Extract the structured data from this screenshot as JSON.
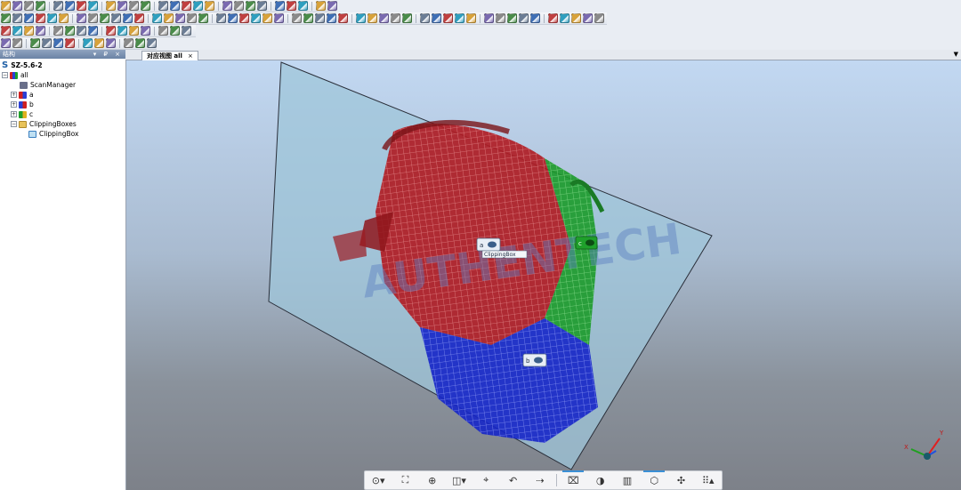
{
  "panel": {
    "title": "结构",
    "controls": "▾ ₽ ×",
    "tree": [
      {
        "label": "SZ-5.6-2",
        "bold": true
      },
      {
        "label": "all"
      },
      {
        "label": "ScanManager"
      },
      {
        "label": "a"
      },
      {
        "label": "b"
      },
      {
        "label": "c"
      },
      {
        "label": "ClippingBoxes"
      },
      {
        "label": "ClippingBox"
      }
    ]
  },
  "tabs": {
    "main_label": "对应视图 all",
    "close_glyph": "×",
    "dropdown_glyph": "▼"
  },
  "viewport": {
    "watermark": "AUTHENTECH",
    "scan_labels": {
      "label_a": "a",
      "label_b": "b",
      "label_c": "c",
      "clipping_tag": "ClippingBox"
    },
    "axes": {
      "x": "X",
      "y": "Y"
    },
    "colors": {
      "scan_a": "#c8202a",
      "scan_b": "#1c2fd0",
      "scan_c": "#1fa02b",
      "clip_box": "#9fc5d9"
    }
  },
  "bottom_toolbar": [
    {
      "name": "navigation-mode-button",
      "glyph": "⊙▾"
    },
    {
      "name": "view-pan-button",
      "glyph": "⛶"
    },
    {
      "name": "zoom-fit-button",
      "glyph": "⊕"
    },
    {
      "name": "standard-views-button",
      "glyph": "◫▾"
    },
    {
      "name": "rotate-button",
      "glyph": "⌖"
    },
    {
      "name": "flip-view-button",
      "glyph": "↶"
    },
    {
      "name": "walk-mode-button",
      "glyph": "⇢"
    },
    {
      "name": "clipping-box-button",
      "glyph": "⌧",
      "active": true
    },
    {
      "name": "clipping-plane-button",
      "glyph": "◑"
    },
    {
      "name": "section-button",
      "glyph": "▥"
    },
    {
      "name": "cube-view-button",
      "glyph": "⬡",
      "active": true
    },
    {
      "name": "points-display-button",
      "glyph": "✣"
    },
    {
      "name": "grid-display-button",
      "glyph": "⠿▴"
    }
  ]
}
